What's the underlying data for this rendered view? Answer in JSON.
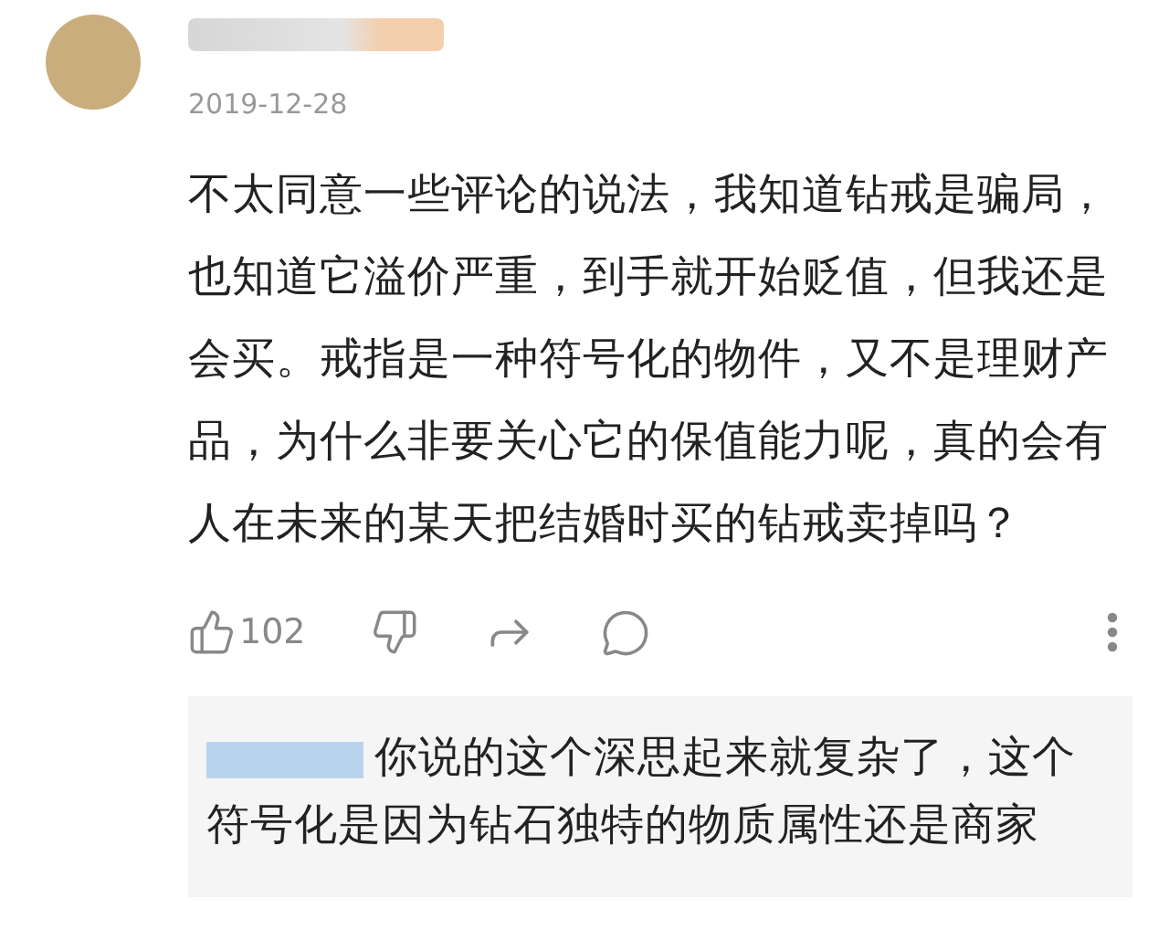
{
  "comment": {
    "date": "2019-12-28",
    "text": "不太同意一些评论的说法，我知道钻戒是骗局，也知道它溢价严重，到手就开始贬值，但我还是会买。戒指是一种符号化的物件，又不是理财产品，为什么非要关心它的保值能力呢，真的会有人在未来的某天把结婚时买的钻戒卖掉吗？",
    "likes": "102"
  },
  "reply": {
    "text": "你说的这个深思起来就复杂了，这个符号化是因为钻石独特的物质属性还是商家"
  }
}
